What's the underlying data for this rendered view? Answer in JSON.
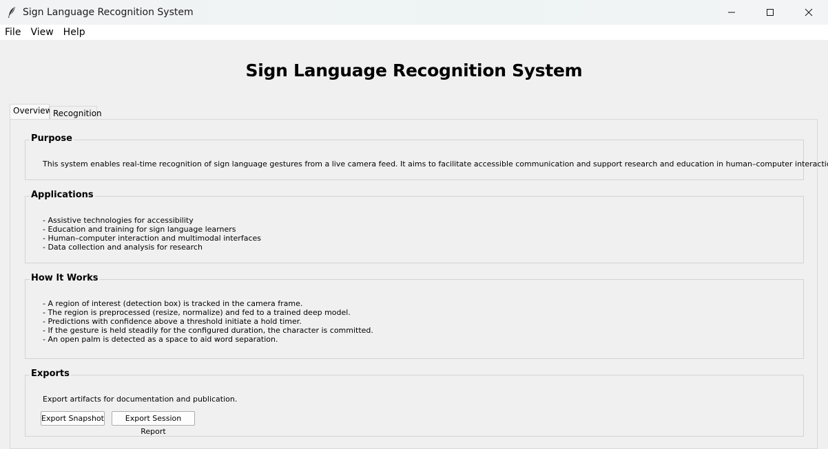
{
  "window": {
    "title": "Sign Language Recognition System",
    "controls": [
      "minimize",
      "maximize",
      "close"
    ]
  },
  "menu": {
    "items": [
      {
        "label": "File"
      },
      {
        "label": "View"
      },
      {
        "label": "Help"
      }
    ]
  },
  "page": {
    "title": "Sign Language Recognition System"
  },
  "tabs": [
    {
      "label": "Overview",
      "active": true
    },
    {
      "label": "Recognition",
      "active": false
    }
  ],
  "sections": {
    "purpose": {
      "title": "Purpose",
      "text": "This system enables real-time recognition of sign language gestures from a live camera feed. It aims to facilitate accessible communication and support research and education in human–computer interaction."
    },
    "applications": {
      "title": "Applications",
      "lines": [
        "- Assistive technologies for accessibility",
        "- Education and training for sign language learners",
        "- Human–computer interaction and multimodal interfaces",
        "- Data collection and analysis for research"
      ]
    },
    "how_it_works": {
      "title": "How It Works",
      "lines": [
        "- A region of interest (detection box) is tracked in the camera frame.",
        "- The region is preprocessed (resize, normalize) and fed to a trained deep model.",
        "- Predictions with confidence above a threshold initiate a hold timer.",
        "- If the gesture is held steadily for the configured duration, the character is committed.",
        "- An open palm is detected as a space to aid word separation."
      ]
    },
    "exports": {
      "title": "Exports",
      "text": "Export artifacts for documentation and publication.",
      "buttons": [
        {
          "label": "Export Snapshot"
        },
        {
          "label": "Export Session Report"
        }
      ]
    }
  }
}
